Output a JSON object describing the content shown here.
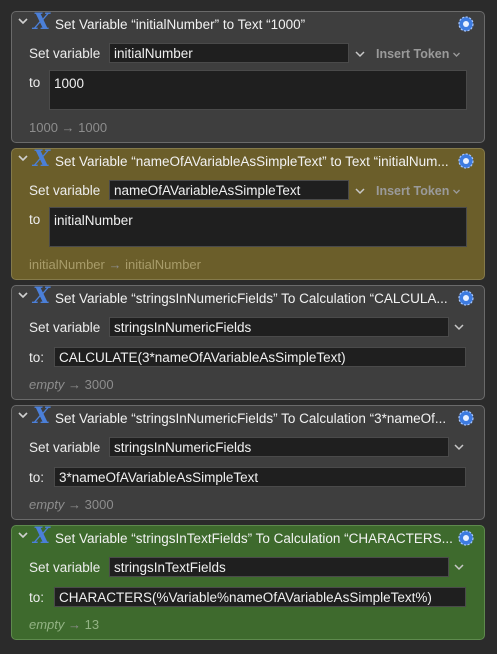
{
  "actions": [
    {
      "title": "Set Variable “initialNumber” to Text “1000”",
      "set_label": "Set variable",
      "variable": "initialNumber",
      "insert_token": "Insert Token",
      "to_label": "to",
      "value": "1000",
      "result_left": "1000",
      "result_arrow": "→",
      "result_right": "1000",
      "color": "#3e3e3e"
    },
    {
      "title": "Set Variable “nameOfAVariableAsSimpleText” to Text “initialNum...",
      "set_label": "Set variable",
      "variable": "nameOfAVariableAsSimpleText",
      "insert_token": "Insert Token",
      "to_label": "to",
      "value": "initialNumber",
      "result_left": "initialNumber",
      "result_arrow": "→",
      "result_right": "initialNumber",
      "color": "#6b5e2a"
    },
    {
      "title": "Set Variable “stringsInNumericFields” To Calculation “CALCULA...",
      "set_label": "Set variable",
      "variable": "stringsInNumericFields",
      "to_label": "to:",
      "value": "CALCULATE(3*nameOfAVariableAsSimpleText)",
      "result_left": "empty",
      "result_arrow": "→",
      "result_right": "3000",
      "color": "#3e3e3e"
    },
    {
      "title": "Set Variable “stringsInNumericFields” To Calculation “3*nameOf...",
      "set_label": "Set variable",
      "variable": "stringsInNumericFields",
      "to_label": "to:",
      "value": "3*nameOfAVariableAsSimpleText",
      "result_left": "empty",
      "result_arrow": "→",
      "result_right": "3000",
      "color": "#3e3e3e"
    },
    {
      "title": "Set Variable “stringsInTextFields” To Calculation “CHARACTERS...",
      "set_label": "Set variable",
      "variable": "stringsInTextFields",
      "to_label": "to:",
      "value": "CHARACTERS(%Variable%nameOfAVariableAsSimpleText%)",
      "result_left": "empty",
      "result_arrow": "→",
      "result_right": "13",
      "color": "#3e6a2d"
    }
  ],
  "icons": {
    "action": "variable-x-icon",
    "settings": "gear-icon",
    "collapse": "chevron-down-icon",
    "dropdown": "chevron-down-icon"
  }
}
